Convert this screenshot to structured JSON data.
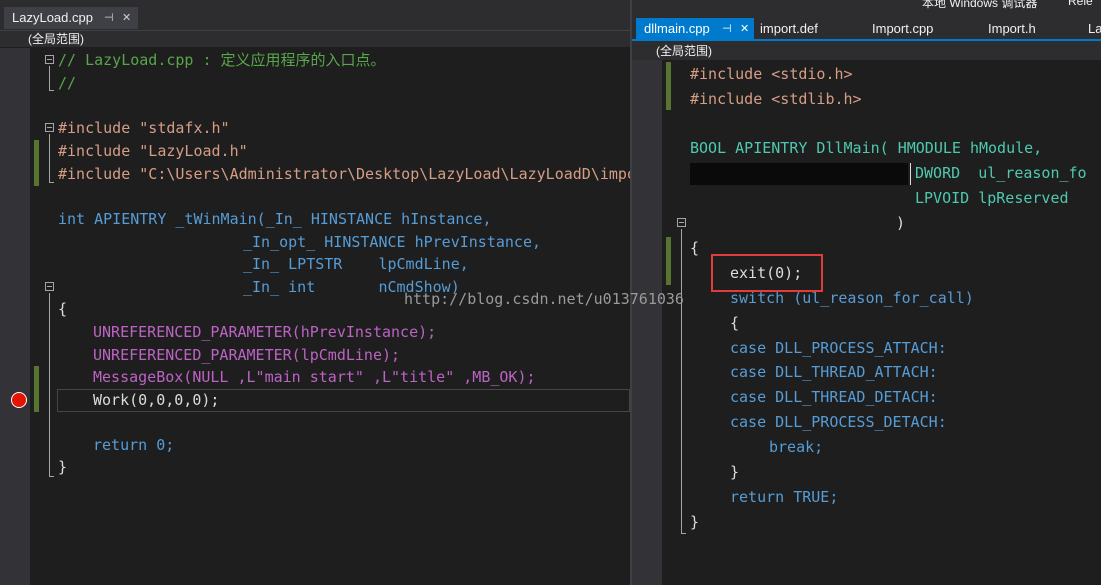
{
  "left": {
    "tab": {
      "title": "LazyLoad.cpp",
      "pin": "⊣",
      "close": "✕"
    },
    "scope": "(全局范围)",
    "lines": [
      "// LazyLoad.cpp : 定义应用程序的入口点。",
      "//",
      "#include \"stdafx.h\"",
      "#include \"LazyLoad.h\"",
      "#include \"C:\\Users\\Administrator\\Desktop\\LazyLoad\\LazyLoadD\\impor",
      "int APIENTRY _tWinMain(_In_ HINSTANCE hInstance,",
      "_In_opt_ HINSTANCE hPrevInstance,",
      "_In_ LPTSTR    lpCmdLine,",
      "_In_ int       nCmdShow)",
      "{",
      "UNREFERENCED_PARAMETER(hPrevInstance);",
      "UNREFERENCED_PARAMETER(lpCmdLine);",
      "MessageBox(NULL ,L\"main start\" ,L\"title\" ,MB_OK);",
      "Work(0,0,0,0);",
      "return 0;",
      "}"
    ]
  },
  "right": {
    "tabs": [
      {
        "title": "dllmain.cpp",
        "pin": "⊣",
        "close": "✕"
      },
      {
        "title": "import.def"
      },
      {
        "title": "Import.cpp"
      },
      {
        "title": "Import.h"
      },
      {
        "title": "La"
      }
    ],
    "toolbar_text": "本地 Windows 调试器",
    "toolbar_right": "Rele",
    "scope": "(全局范围)",
    "lines": [
      "#include <stdio.h>",
      "#include <stdlib.h>",
      "BOOL APIENTRY DllMain( HMODULE hModule,",
      "DWORD  ul_reason_fo",
      "LPVOID lpReserved",
      ")",
      "{",
      "exit(0);",
      "switch (ul_reason_for_call)",
      "{",
      "case DLL_PROCESS_ATTACH:",
      "case DLL_THREAD_ATTACH:",
      "case DLL_THREAD_DETACH:",
      "case DLL_PROCESS_DETACH:",
      "break;",
      "}",
      "return TRUE;",
      "}"
    ]
  },
  "watermark": "http://blog.csdn.net/u013761036",
  "colors": {
    "background": "#1e1e1e",
    "comment": "#57a64a",
    "keyword": "#569cd6",
    "string": "#d69d85",
    "macro": "#bd63c5",
    "type": "#4ec9b0",
    "accent": "#007acc",
    "breakpoint": "#e51400",
    "annotation_box": "#e03c3c"
  }
}
